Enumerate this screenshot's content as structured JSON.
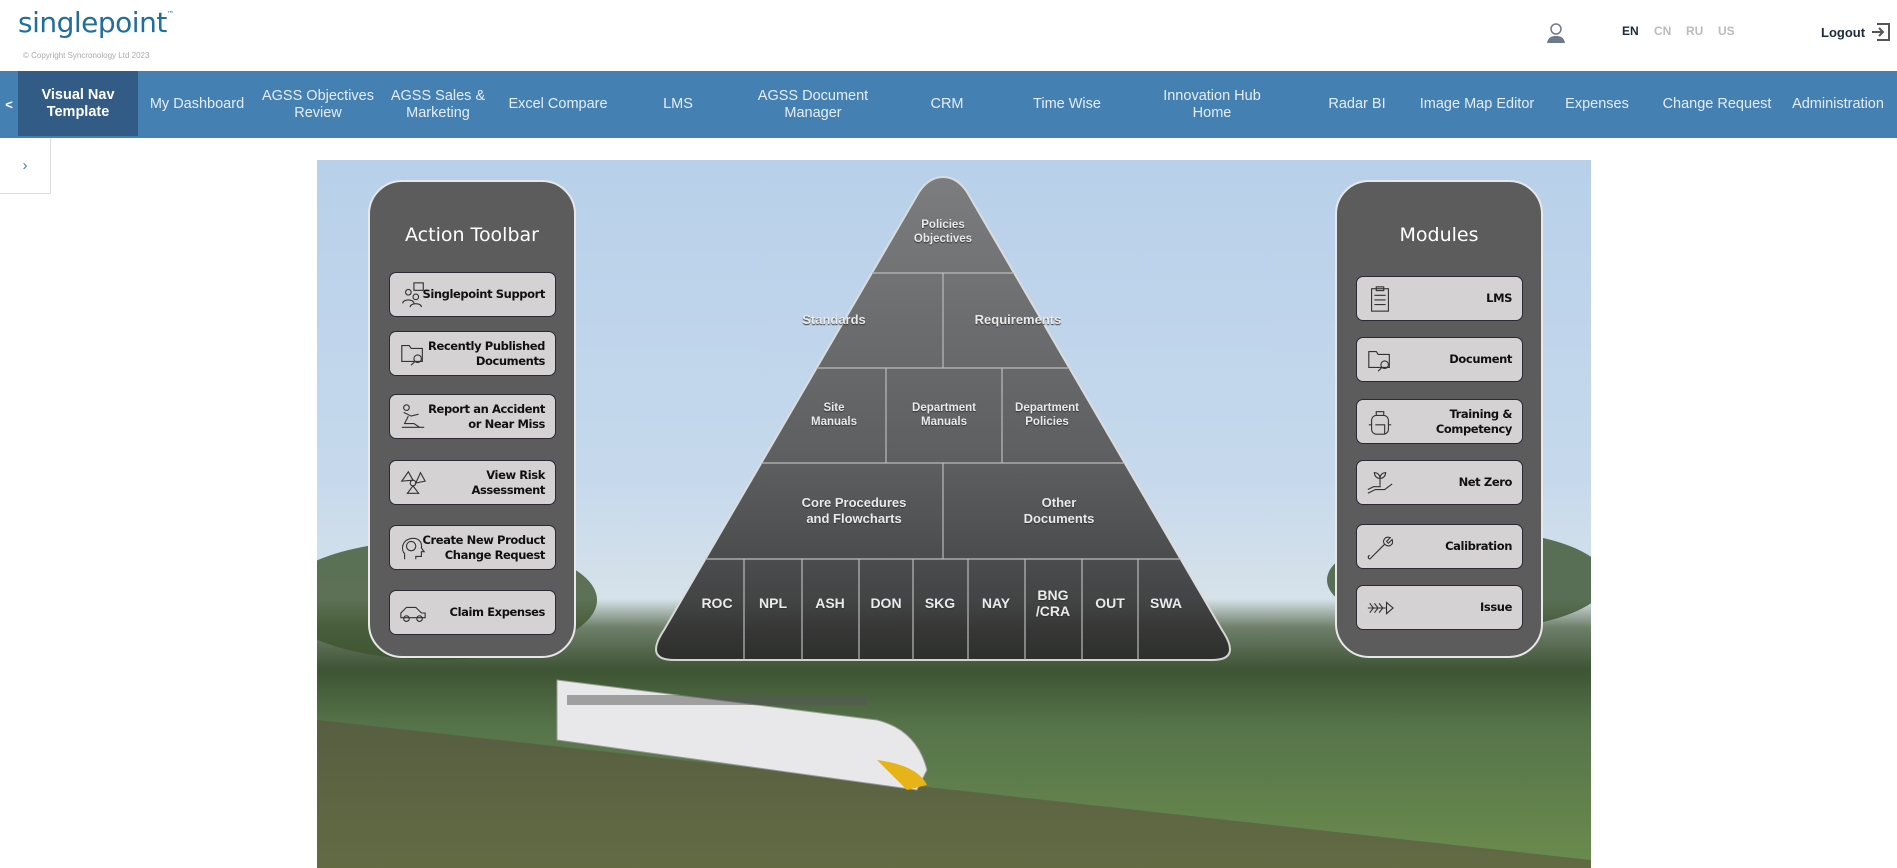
{
  "header": {
    "logo": "singlepoint",
    "trademark": "™",
    "copyright": "© Copyright Syncronology Ltd 2023",
    "languages": [
      {
        "code": "EN",
        "active": true
      },
      {
        "code": "CN",
        "active": false
      },
      {
        "code": "RU",
        "active": false
      },
      {
        "code": "US",
        "active": false
      }
    ],
    "logout": "Logout"
  },
  "nav": {
    "back": "<",
    "items": [
      {
        "label": "Visual Nav\nTemplate",
        "active": true
      },
      {
        "label": "My Dashboard"
      },
      {
        "label": "AGSS Objectives\nReview"
      },
      {
        "label": "AGSS Sales &\nMarketing"
      },
      {
        "label": "Excel Compare"
      },
      {
        "label": "LMS"
      },
      {
        "label": "AGSS Document\nManager"
      },
      {
        "label": "CRM"
      },
      {
        "label": "Time Wise"
      },
      {
        "label": "Innovation Hub Home"
      },
      {
        "label": "Radar BI"
      },
      {
        "label": "Image Map Editor"
      },
      {
        "label": "Expenses"
      },
      {
        "label": "Change Request"
      },
      {
        "label": "Administration"
      }
    ],
    "side_toggle": "›",
    "accent": "#4580b3",
    "active_bg": "#325b86"
  },
  "action_toolbar": {
    "title": "Action Toolbar",
    "items": [
      {
        "label": "Singlepoint Support",
        "icon": "support-people-icon"
      },
      {
        "label": "Recently Published\nDocuments",
        "icon": "folder-search-icon"
      },
      {
        "label": "Report an Accident\nor Near Miss",
        "icon": "slip-fall-icon"
      },
      {
        "label": "View Risk\nAssessment",
        "icon": "radiation-icon"
      },
      {
        "label": "Create New Product\nChange Request",
        "icon": "head-lightbulb-icon"
      },
      {
        "label": "Claim Expenses",
        "icon": "car-icon"
      }
    ]
  },
  "modules": {
    "title": "Modules",
    "items": [
      {
        "label": "LMS",
        "icon": "clipboard-checklist-icon"
      },
      {
        "label": "Document",
        "icon": "folder-search-icon"
      },
      {
        "label": "Training &\nCompetency",
        "icon": "backpack-icon"
      },
      {
        "label": "Net Zero",
        "icon": "hand-plant-icon"
      },
      {
        "label": "Calibration",
        "icon": "wrench-icon"
      },
      {
        "label": "Issue",
        "icon": "fishbone-icon"
      }
    ]
  },
  "pyramid": {
    "top": "Policies\nObjectives",
    "row2": [
      "Standards",
      "Requirements"
    ],
    "row3": [
      "Site\nManuals",
      "Department\nManuals",
      "Department\nPolicies"
    ],
    "row4": [
      "Core Procedures\nand Flowcharts",
      "Other\nDocuments"
    ],
    "sites": [
      "ROC",
      "NPL",
      "ASH",
      "DON",
      "SKG",
      "NAY",
      "BNG\n/CRA",
      "OUT",
      "SWA"
    ]
  }
}
